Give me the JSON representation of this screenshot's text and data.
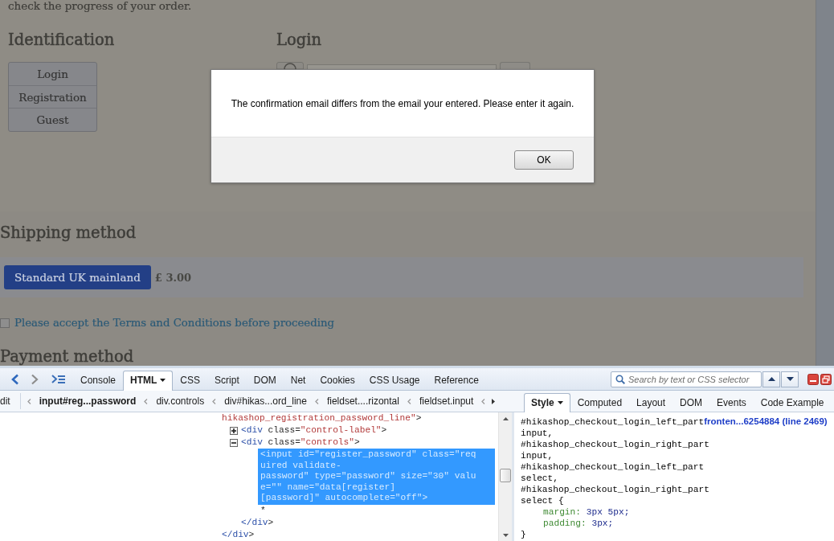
{
  "page": {
    "intro": "check the progress of your order.",
    "identification": {
      "title": "Identification",
      "options": [
        "Login",
        "Registration",
        "Guest"
      ]
    },
    "login": {
      "title": "Login"
    },
    "shipping": {
      "title": "Shipping method",
      "methods": [
        {
          "label": "Standard UK mainland",
          "price": "£ 3.00",
          "selected": true
        }
      ]
    },
    "terms": {
      "checked": false,
      "text": "Please accept the Terms and Conditions before proceeding"
    },
    "payment": {
      "title": "Payment method"
    }
  },
  "dialog": {
    "message": "The confirmation email differs from the email your entered. Please enter it again.",
    "buttons": [
      "OK"
    ]
  },
  "devtools": {
    "panel_tabs": [
      {
        "label": "Console",
        "selected": false,
        "dropdown": false
      },
      {
        "label": "HTML",
        "selected": true,
        "dropdown": true
      },
      {
        "label": "CSS",
        "selected": false,
        "dropdown": false
      },
      {
        "label": "Script",
        "selected": false,
        "dropdown": false
      },
      {
        "label": "DOM",
        "selected": false,
        "dropdown": false
      },
      {
        "label": "Net",
        "selected": false,
        "dropdown": false
      },
      {
        "label": "Cookies",
        "selected": false,
        "dropdown": false
      },
      {
        "label": "CSS Usage",
        "selected": false,
        "dropdown": false
      },
      {
        "label": "Reference",
        "selected": false,
        "dropdown": false
      }
    ],
    "search": {
      "placeholder": "Search by text or CSS selector"
    },
    "edit_button": {
      "label": "dit"
    },
    "breadcrumbs": [
      {
        "label": "input#reg...password",
        "selected": true
      },
      {
        "label": "div.controls",
        "selected": false
      },
      {
        "label": "div#hikas...ord_line",
        "selected": false
      },
      {
        "label": "fieldset....rizontal",
        "selected": false
      },
      {
        "label": "fieldset.input",
        "selected": false
      }
    ],
    "side_tabs": [
      {
        "label": "Style",
        "selected": true,
        "dropdown": true
      },
      {
        "label": "Computed",
        "selected": false,
        "dropdown": false
      },
      {
        "label": "Layout",
        "selected": false,
        "dropdown": false
      },
      {
        "label": "DOM",
        "selected": false,
        "dropdown": false
      },
      {
        "label": "Events",
        "selected": false,
        "dropdown": false
      },
      {
        "label": "Code Example",
        "selected": false,
        "dropdown": false
      }
    ],
    "html_tree": [
      {
        "lines": [
          "hikashop_registration_password_line\">"
        ],
        "selected": false,
        "close": "</div>",
        "children": [
          {
            "lines": [
              "<div class=\"control-label\">"
            ],
            "expanded": false,
            "selected": false
          },
          {
            "lines": [
              "<div class=\"controls\">"
            ],
            "expanded": true,
            "selected": false,
            "close": "</div>",
            "children": [
              {
                "lines": [
                  "<input id=\"register_password\" class=\"req",
                  "uired validate-",
                  "password\" type=\"password\" size=\"30\" valu",
                  "e=\"\" name=\"data[register]",
                  "[password]\" autocomplete=\"off\">"
                ],
                "selected": true
              },
              {
                "lines": [
                  "*"
                ],
                "selected": false
              }
            ]
          }
        ]
      }
    ],
    "style_rules": [
      {
        "selectors": [
          "#hikashop_checkout_login_left_part",
          "input,",
          "#hikashop_checkout_login_right_part",
          "input,",
          "#hikashop_checkout_login_left_part",
          "select,",
          "#hikashop_checkout_login_right_part",
          "select {"
        ],
        "source": "fronten...6254884 (line 2469)",
        "declarations": [
          {
            "property": "margin:",
            "value": "3px 5px;"
          },
          {
            "property": "padding:",
            "value": "3px;"
          }
        ],
        "close": "}"
      }
    ]
  }
}
